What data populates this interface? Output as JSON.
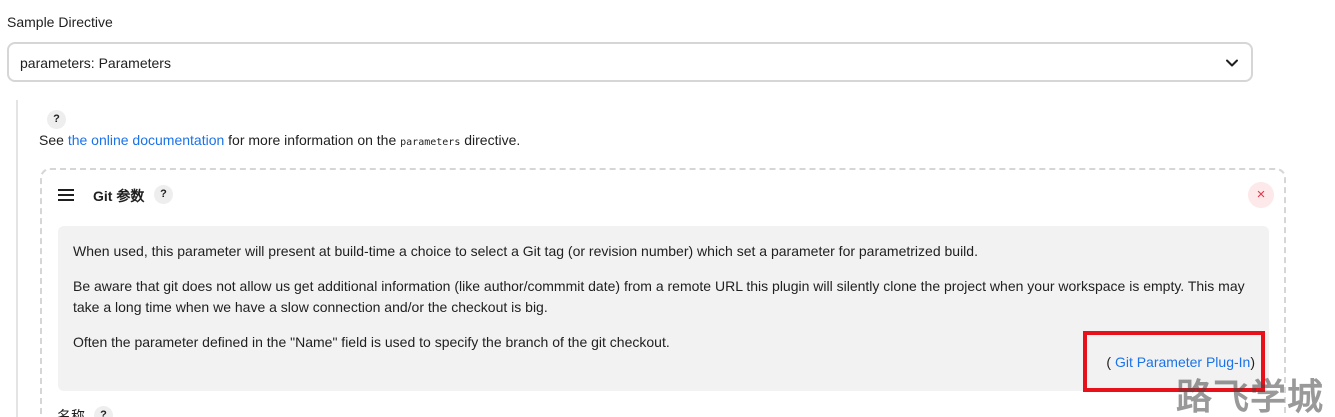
{
  "sample_directive": {
    "label": "Sample Directive",
    "selected": "parameters: Parameters"
  },
  "help_symbol": "?",
  "docs": {
    "prefix": "See ",
    "link_text": "the online documentation",
    "middle": " for more information on the ",
    "code": "parameters",
    "suffix": " directive."
  },
  "param_card": {
    "title": "Git 参数",
    "close_symbol": "×",
    "description": [
      "When used, this parameter will present at build-time a choice to select a Git tag (or revision number) which set a parameter for parametrized build.",
      "Be aware that git does not allow us get additional information (like author/commmit date) from a remote URL this plugin will silently clone the project when your workspace is empty. This may take a long time when we have a slow connection and/or the checkout is big.",
      "Often the parameter defined in the \"Name\" field is used to specify the branch of the git checkout."
    ],
    "plugin_prefix": "( ",
    "plugin_link": "Git Parameter Plug-In",
    "plugin_suffix": ")",
    "name_label": "名称"
  },
  "watermark": "路飞学城",
  "colors": {
    "link": "#1a73e8",
    "highlight": "#e8101a",
    "close": "#e5364a"
  }
}
